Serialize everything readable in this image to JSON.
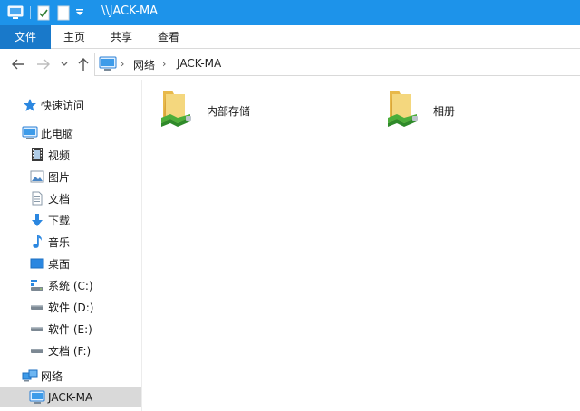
{
  "window": {
    "title": "\\\\JACK-MA",
    "colors": {
      "titlebar": "#1d93ea",
      "file_tab": "#1979ca",
      "selected": "#d9d9d9"
    }
  },
  "quick_access_toolbar": {
    "icons": [
      "computer-icon",
      "properties-icon",
      "new-folder-icon",
      "customize-dropdown-icon"
    ]
  },
  "ribbon": {
    "tabs": [
      {
        "label": "文件"
      },
      {
        "label": "主页"
      },
      {
        "label": "共享"
      },
      {
        "label": "查看"
      }
    ]
  },
  "navigation": {
    "buttons": [
      "back-arrow-icon",
      "forward-arrow-icon",
      "recent-dropdown-icon",
      "up-arrow-icon"
    ],
    "address": {
      "icon": "computer-icon",
      "components": [
        "网络",
        "JACK-MA"
      ]
    }
  },
  "sidebar": {
    "items": [
      {
        "label": "快速访问",
        "icon": "star-icon"
      },
      {
        "label": "此电脑",
        "icon": "computer-icon"
      },
      {
        "label": "视频",
        "icon": "video-icon"
      },
      {
        "label": "图片",
        "icon": "pictures-icon"
      },
      {
        "label": "文档",
        "icon": "document-icon"
      },
      {
        "label": "下载",
        "icon": "download-icon"
      },
      {
        "label": "音乐",
        "icon": "music-icon"
      },
      {
        "label": "桌面",
        "icon": "desktop-icon"
      },
      {
        "label": "系统 (C:)",
        "icon": "system-drive-icon"
      },
      {
        "label": "软件 (D:)",
        "icon": "drive-icon"
      },
      {
        "label": "软件 (E:)",
        "icon": "drive-icon"
      },
      {
        "label": "文档 (F:)",
        "icon": "drive-icon"
      },
      {
        "label": "网络",
        "icon": "network-icon"
      },
      {
        "label": "JACK-MA",
        "icon": "computer-icon",
        "selected": true
      }
    ]
  },
  "content": {
    "shares": [
      {
        "name": "内部存储",
        "icon": "shared-folder-icon"
      },
      {
        "name": "相册",
        "icon": "shared-folder-icon"
      }
    ]
  }
}
